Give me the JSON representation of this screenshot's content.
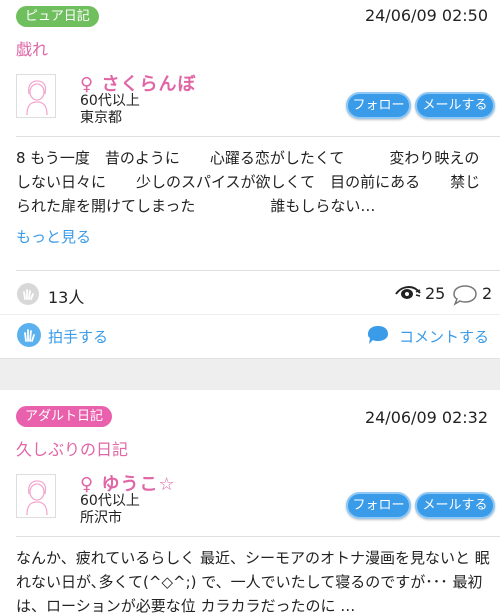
{
  "posts": [
    {
      "badge": "ピュア日記",
      "datetime": "24/06/09 02:50",
      "title": "戯れ",
      "user": {
        "name": "♀ さくらんぼ",
        "age": "60代以上",
        "location": "東京都"
      },
      "follow_label": "フォロー",
      "mail_label": "メールする",
      "body": "8 もう一度　昔のように　　心躍る恋がしたくて　　　変わり映えのしない日々に　　少しのスパイスが欲しくて　目の前にある　　禁じられた扉を開けてしまった　　　　　誰もしらない…",
      "more_label": "もっと見る",
      "clap_count": "13人",
      "view_count": "25",
      "comment_count": "2",
      "clap_label": "拍手する",
      "comment_label": "コメントする"
    },
    {
      "badge": "アダルト日記",
      "datetime": "24/06/09 02:32",
      "title": "久しぶりの日記",
      "user": {
        "name": "♀ ゆうこ☆",
        "age": "60代以上",
        "location": "所沢市"
      },
      "follow_label": "フォロー",
      "mail_label": "メールする",
      "body": "なんか、疲れているらしく 最近、シーモアのオトナ漫画を見ないと 眠れない日が､多くて(^◇^;) で、一人でいたして寝るのですが･･･ 最初は、ローションが必要な位 カラカラだったのに …"
    }
  ],
  "colors": {
    "accent": "#3a9be8",
    "pink": "#e066a6",
    "badge_green": "#6fbf5e",
    "badge_pink": "#e961ad"
  }
}
